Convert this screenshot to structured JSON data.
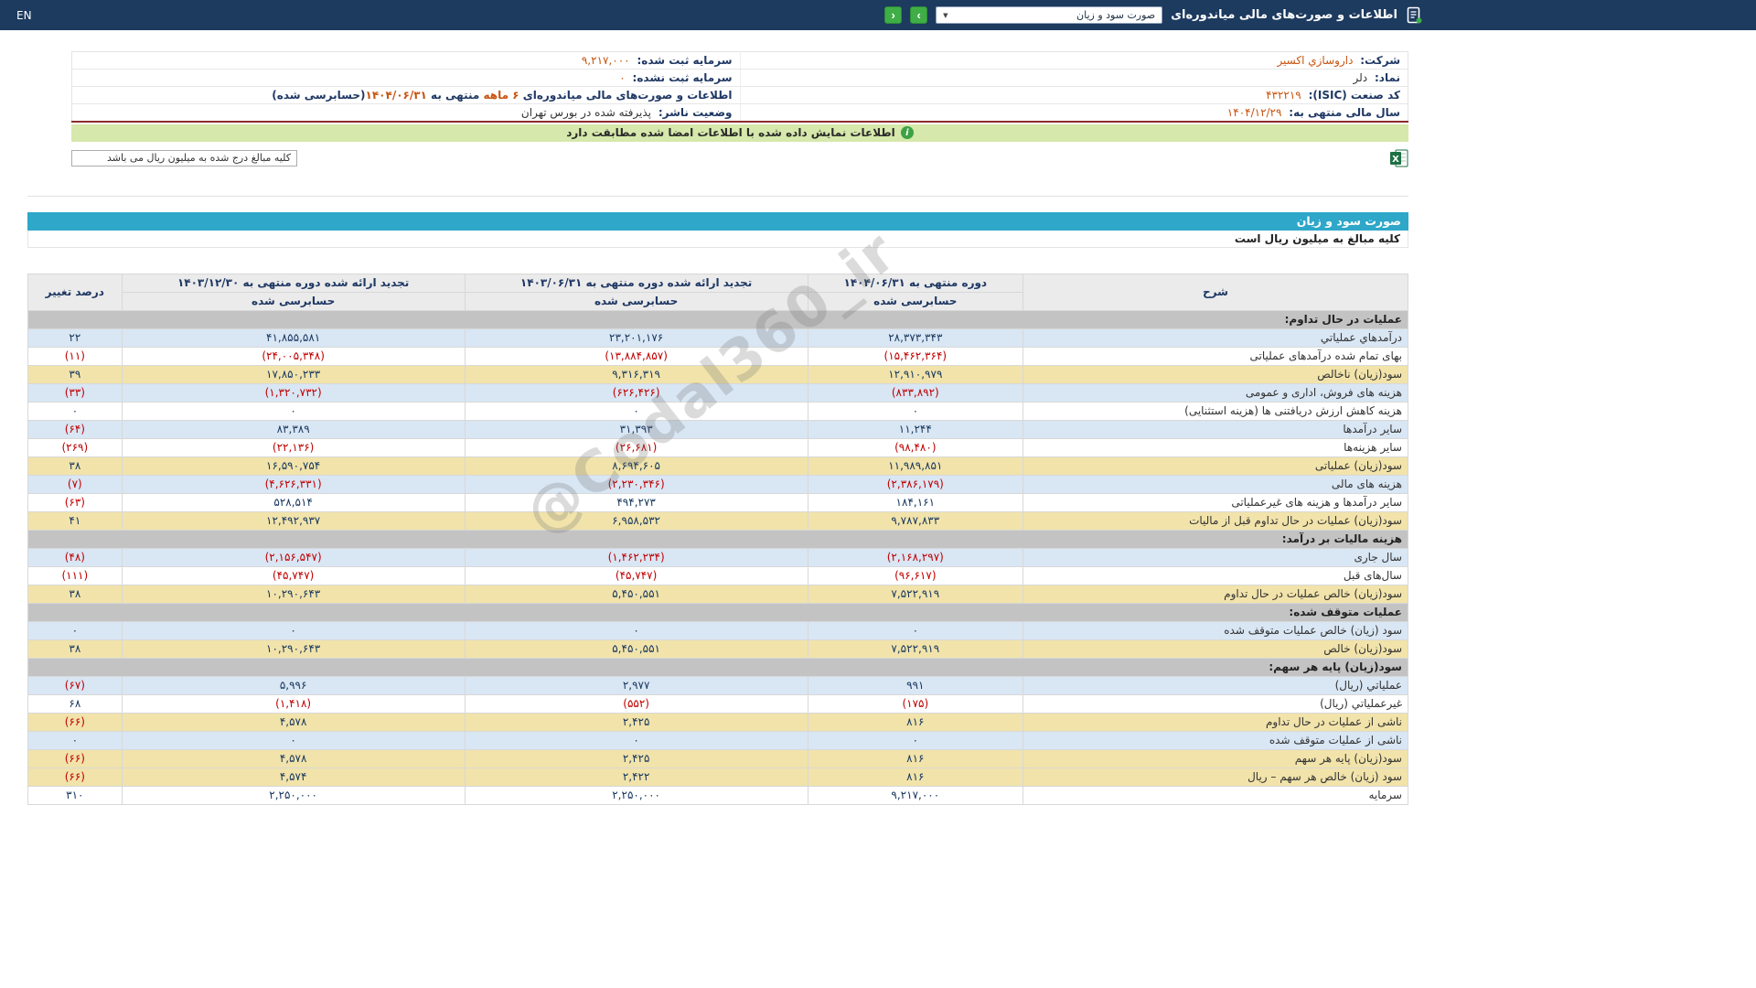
{
  "colors": {
    "navbar_navy": "#1d3a5f",
    "accent_teal": "#2ea7c9",
    "stripe_blue": "#d9e6f4",
    "highlight_yellow": "#f1e3aa",
    "section_gray": "#c3c3c3",
    "negative_red": "#c00000",
    "value_orange": "#c85410",
    "banner_green": "#d6e8ab",
    "button_green": "#3fae47"
  },
  "icons": {
    "caret_glyph": "▼",
    "forward_glyph": "›",
    "back_glyph": "‹",
    "info_glyph": "i"
  },
  "navbar": {
    "title": "اطلاعات و صورت‌های مالی میاندوره‌ای",
    "statement_select": "صورت سود و زیان",
    "en_label": "EN"
  },
  "company": {
    "rows": [
      {
        "r_label": "شرکت:",
        "r_value": "داروسازي اکسير",
        "l_label": "سرمایه ثبت شده:",
        "l_value": "۹,۲۱۷,۰۰۰"
      },
      {
        "r_label": "نماد:",
        "r_value": "دلر",
        "l_label": "سرمایه ثبت نشده:",
        "l_value": "۰"
      },
      {
        "r_label": "کد صنعت (ISIC):",
        "r_value": "۴۳۲۲۱۹"
      },
      {
        "r_label": "سال مالی منتهی به:",
        "r_value": "۱۴۰۴/۱۲/۲۹",
        "l_label": "وضعیت ناشر:",
        "l_value": "پذيرفته شده در بورس تهران"
      }
    ],
    "period_line": {
      "p1": "اطلاعات و صورت‌های مالی میاندوره‌ای ",
      "p2": "۶ ماهه",
      "p3": " منتهی به ",
      "p4": "۱۴۰۴/۰۶/۳۱",
      "p5": "(حسابرسی شده)"
    },
    "banner_text": "اطلاعات نمایش داده شده با اطلاعات امضا شده مطابقت دارد",
    "units_box_text": "کلیه مبالغ درج شده به میلیون ریال می باشد"
  },
  "statement": {
    "title": "صورت سود و زیان",
    "units_note": "کلیه مبالغ به میلیون ریال است",
    "watermark": "@Codal360_ir",
    "columns": {
      "desc": "شرح",
      "current": "دوره منتهی به ۱۴۰۴/۰۶/۳۱",
      "restated_half": "تجدید ارائه شده دوره منتهی به ۱۴۰۳/۰۶/۳۱",
      "restated_year": "تجدید ارائه شده دوره منتهی به ۱۴۰۳/۱۲/۳۰",
      "change": "درصد تغییر",
      "audited": "حسابرسی شده"
    },
    "rows": [
      {
        "type": "section",
        "label": "عملیات در حال تداوم:"
      },
      {
        "type": "data",
        "bg": "blue",
        "label": "درآمدهاي عملياتي",
        "values": [
          "۲۸,۳۷۳,۳۴۳",
          "۲۳,۲۰۱,۱۷۶",
          "۴۱,۸۵۵,۵۸۱",
          "۲۲"
        ]
      },
      {
        "type": "data",
        "bg": "white",
        "label": "بهای تمام شده درآمدهای عملیاتی",
        "values": [
          "(۱۵,۴۶۲,۳۶۴)",
          "(۱۳,۸۸۴,۸۵۷)",
          "(۲۴,۰۰۵,۳۴۸)",
          "(۱۱)"
        ]
      },
      {
        "type": "data",
        "bg": "yellow",
        "label": "سود(زیان) ناخالص",
        "values": [
          "۱۲,۹۱۰,۹۷۹",
          "۹,۳۱۶,۳۱۹",
          "۱۷,۸۵۰,۲۳۳",
          "۳۹"
        ]
      },
      {
        "type": "data",
        "bg": "blue",
        "label": "هزینه های فروش، اداری و عمومی",
        "values": [
          "(۸۳۳,۸۹۲)",
          "(۶۲۶,۴۲۶)",
          "(۱,۳۲۰,۷۳۲)",
          "(۳۳)"
        ]
      },
      {
        "type": "data",
        "bg": "white",
        "label": "هزینه کاهش ارزش دریافتنی ها (هزینه استثنایی)",
        "values": [
          "۰",
          "۰",
          "۰",
          "۰"
        ]
      },
      {
        "type": "data",
        "bg": "blue",
        "label": "سایر درآمدها",
        "values": [
          "۱۱,۲۴۴",
          "۳۱,۳۹۳",
          "۸۳,۳۸۹",
          "(۶۴)"
        ]
      },
      {
        "type": "data",
        "bg": "white",
        "label": "سایر هزینه‌ها",
        "values": [
          "(۹۸,۴۸۰)",
          "(۲۶,۶۸۱)",
          "(۲۲,۱۳۶)",
          "(۲۶۹)"
        ]
      },
      {
        "type": "data",
        "bg": "yellow",
        "label": "سود(زیان) عملیاتی",
        "values": [
          "۱۱,۹۸۹,۸۵۱",
          "۸,۶۹۴,۶۰۵",
          "۱۶,۵۹۰,۷۵۴",
          "۳۸"
        ]
      },
      {
        "type": "data",
        "bg": "blue",
        "label": "هزینه های مالی",
        "values": [
          "(۲,۳۸۶,۱۷۹)",
          "(۲,۲۳۰,۳۴۶)",
          "(۴,۶۲۶,۳۳۱)",
          "(۷)"
        ]
      },
      {
        "type": "data",
        "bg": "white",
        "label": "سایر درآمدها و هزینه های غیرعملیاتی",
        "values": [
          "۱۸۴,۱۶۱",
          "۴۹۴,۲۷۳",
          "۵۲۸,۵۱۴",
          "(۶۳)"
        ]
      },
      {
        "type": "data",
        "bg": "yellow",
        "label": "سود(زیان) عملیات در حال تداوم قبل از مالیات",
        "values": [
          "۹,۷۸۷,۸۳۳",
          "۶,۹۵۸,۵۳۲",
          "۱۲,۴۹۲,۹۳۷",
          "۴۱"
        ]
      },
      {
        "type": "section",
        "label": "هزینه مالیات بر درآمد:"
      },
      {
        "type": "data",
        "bg": "blue",
        "label": "سال جاری",
        "values": [
          "(۲,۱۶۸,۲۹۷)",
          "(۱,۴۶۲,۲۳۴)",
          "(۲,۱۵۶,۵۴۷)",
          "(۴۸)"
        ]
      },
      {
        "type": "data",
        "bg": "white",
        "label": "سال‌های قبل",
        "values": [
          "(۹۶,۶۱۷)",
          "(۴۵,۷۴۷)",
          "(۴۵,۷۴۷)",
          "(۱۱۱)"
        ]
      },
      {
        "type": "data",
        "bg": "yellow",
        "label": "سود(زیان) خالص عملیات در حال تداوم",
        "values": [
          "۷,۵۲۲,۹۱۹",
          "۵,۴۵۰,۵۵۱",
          "۱۰,۲۹۰,۶۴۳",
          "۳۸"
        ]
      },
      {
        "type": "section",
        "label": "عملیات متوقف شده:"
      },
      {
        "type": "data",
        "bg": "blue",
        "label": "سود (زیان) خالص عملیات متوقف شده",
        "values": [
          "۰",
          "۰",
          "۰",
          "۰"
        ]
      },
      {
        "type": "data",
        "bg": "yellow",
        "label": "سود(زیان) خالص",
        "values": [
          "۷,۵۲۲,۹۱۹",
          "۵,۴۵۰,۵۵۱",
          "۱۰,۲۹۰,۶۴۳",
          "۳۸"
        ]
      },
      {
        "type": "section",
        "label": "سود(زیان) پایه هر سهم:"
      },
      {
        "type": "data",
        "bg": "blue",
        "label": "عملیاتي (ریال)",
        "values": [
          "۹۹۱",
          "۲,۹۷۷",
          "۵,۹۹۶",
          "(۶۷)"
        ]
      },
      {
        "type": "data",
        "bg": "white",
        "label": "غیرعملیاتي (ریال)",
        "values": [
          "(۱۷۵)",
          "(۵۵۲)",
          "(۱,۴۱۸)",
          "۶۸"
        ]
      },
      {
        "type": "data",
        "bg": "yellow",
        "label": "ناشی از عملیات در حال تداوم",
        "values": [
          "۸۱۶",
          "۲,۴۲۵",
          "۴,۵۷۸",
          "(۶۶)"
        ]
      },
      {
        "type": "data",
        "bg": "blue",
        "label": "ناشی از عملیات متوقف شده",
        "values": [
          "۰",
          "۰",
          "۰",
          "۰"
        ]
      },
      {
        "type": "data",
        "bg": "yellow",
        "label": "سود(زیان) پایه هر سهم",
        "values": [
          "۸۱۶",
          "۲,۴۲۵",
          "۴,۵۷۸",
          "(۶۶)"
        ]
      },
      {
        "type": "data",
        "bg": "yellow",
        "label": "سود (زیان) خالص هر سهم – ریال",
        "values": [
          "۸۱۶",
          "۲,۴۲۲",
          "۴,۵۷۴",
          "(۶۶)"
        ]
      },
      {
        "type": "data",
        "bg": "white",
        "label": "سرمایه",
        "values": [
          "۹,۲۱۷,۰۰۰",
          "۲,۲۵۰,۰۰۰",
          "۲,۲۵۰,۰۰۰",
          "۳۱۰"
        ]
      }
    ]
  }
}
